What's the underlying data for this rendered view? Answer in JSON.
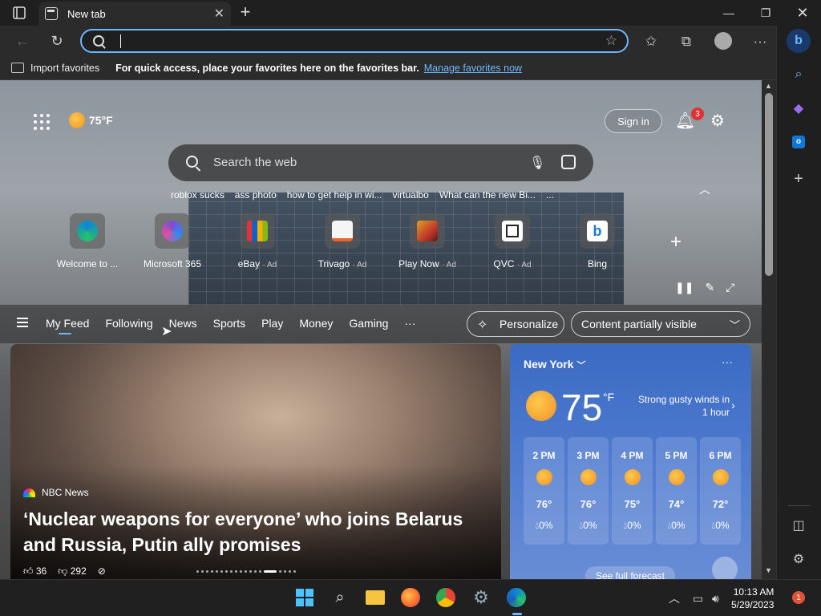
{
  "tab": {
    "title": "New tab"
  },
  "favorites_bar": {
    "import_label": "Import favorites",
    "message": "For quick access, place your favorites here on the favorites bar.",
    "link": "Manage favorites now"
  },
  "newtab": {
    "weather_temp": "75°F",
    "sign_in": "Sign in",
    "notification_count": "3",
    "search_placeholder": "Search the web",
    "trending": [
      "roblox sucks",
      "ass photo",
      "how to get help in wi...",
      "virtualbo",
      "What can the new Bi...",
      "..."
    ],
    "quick_links": [
      {
        "label": "Welcome to ...",
        "ad": "",
        "color": "#0b84d8"
      },
      {
        "label": "Microsoft 365",
        "ad": "",
        "color": "#7a4fd3"
      },
      {
        "label": "eBay",
        "ad": "· Ad",
        "color": "#e53238"
      },
      {
        "label": "Trivago",
        "ad": "· Ad",
        "color": "#f5f5f5"
      },
      {
        "label": "Play Now",
        "ad": "· Ad",
        "color": "#c0392b"
      },
      {
        "label": "QVC",
        "ad": "· Ad",
        "color": "#ffffff"
      },
      {
        "label": "Bing",
        "ad": "",
        "color": "#ffffff"
      }
    ]
  },
  "feed_nav": {
    "tabs": [
      "My Feed",
      "Following",
      "News",
      "Sports",
      "Play",
      "Money",
      "Gaming",
      "···"
    ],
    "personalize": "Personalize",
    "content_visibility": "Content partially visible"
  },
  "hero": {
    "source": "NBC News",
    "headline": "‘Nuclear weapons for everyone’ who joins Belarus and Russia, Putin ally promises",
    "likes": "36",
    "dislikes": "292"
  },
  "weather_card": {
    "city": "New York",
    "temp": "75",
    "unit": "°F",
    "alert": "Strong gusty winds in 1 hour",
    "hourly": [
      {
        "time": "2 PM",
        "temp": "76°",
        "precip": "0%"
      },
      {
        "time": "3 PM",
        "temp": "76°",
        "precip": "0%"
      },
      {
        "time": "4 PM",
        "temp": "75°",
        "precip": "0%"
      },
      {
        "time": "5 PM",
        "temp": "74°",
        "precip": "0%"
      },
      {
        "time": "6 PM",
        "temp": "72°",
        "precip": "0%"
      }
    ],
    "forecast_link": "See full forecast"
  },
  "taskbar": {
    "time": "10:13 AM",
    "date": "5/29/2023",
    "notification_count": "1"
  },
  "colors": {
    "accent": "#6cb8ff",
    "weather_card": "#4f7bd0",
    "badge": "#d33333"
  }
}
